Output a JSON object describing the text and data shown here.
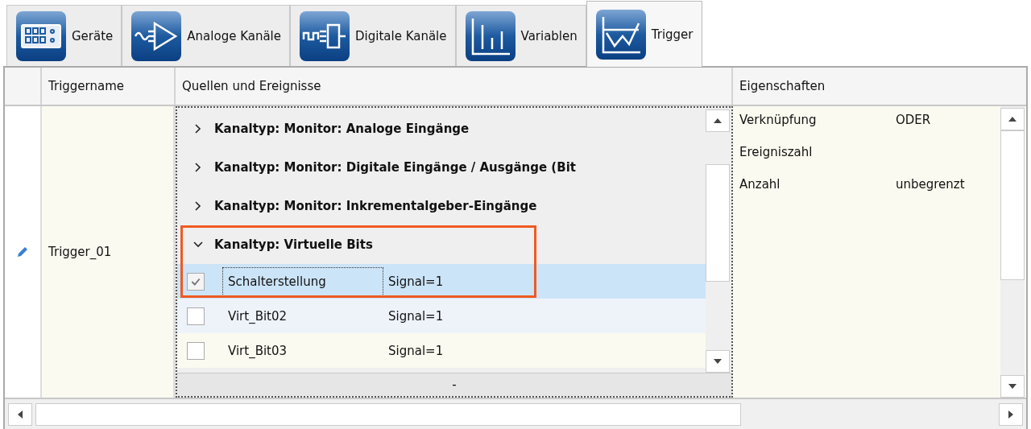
{
  "tabs": [
    {
      "label": "Geräte",
      "kind": "devices",
      "selected": false
    },
    {
      "label": "Analoge Kanäle",
      "kind": "analog",
      "selected": false
    },
    {
      "label": "Digitale Kanäle",
      "kind": "digital",
      "selected": false
    },
    {
      "label": "Variablen",
      "kind": "variables",
      "selected": false
    },
    {
      "label": "Trigger",
      "kind": "trigger",
      "selected": true
    }
  ],
  "table": {
    "columns": [
      "Triggername",
      "Quellen und Ereignisse",
      "Eigenschaften"
    ],
    "rows": [
      {
        "editing": true,
        "name": "Trigger_01",
        "sources": {
          "groups": [
            {
              "label": "Kanaltyp: Monitor: Analoge Eingänge",
              "expanded": false,
              "highlighted": false
            },
            {
              "label": "Kanaltyp: Monitor: Digitale Eingänge / Ausgänge (Bit",
              "expanded": false,
              "highlighted": false
            },
            {
              "label": "Kanaltyp: Monitor: Inkrementalgeber-Eingänge",
              "expanded": false,
              "highlighted": false
            },
            {
              "label": "Kanaltyp: Virtuelle Bits",
              "expanded": true,
              "highlighted": true,
              "items": [
                {
                  "name": "Schalterstellung",
                  "condition": "Signal=1",
                  "checked": true,
                  "selected": true
                },
                {
                  "name": "Virt_Bit02",
                  "condition": "Signal=1",
                  "checked": false,
                  "selected": false
                },
                {
                  "name": "Virt_Bit03",
                  "condition": "Signal=1",
                  "checked": false,
                  "selected": false
                }
              ]
            }
          ],
          "footer": "-"
        },
        "properties": [
          {
            "label": "Verknüpfung",
            "value": "ODER"
          },
          {
            "label": "Ereigniszahl"
          },
          {
            "label": "Anzahl",
            "value": "unbegrenzt"
          }
        ]
      }
    ]
  }
}
